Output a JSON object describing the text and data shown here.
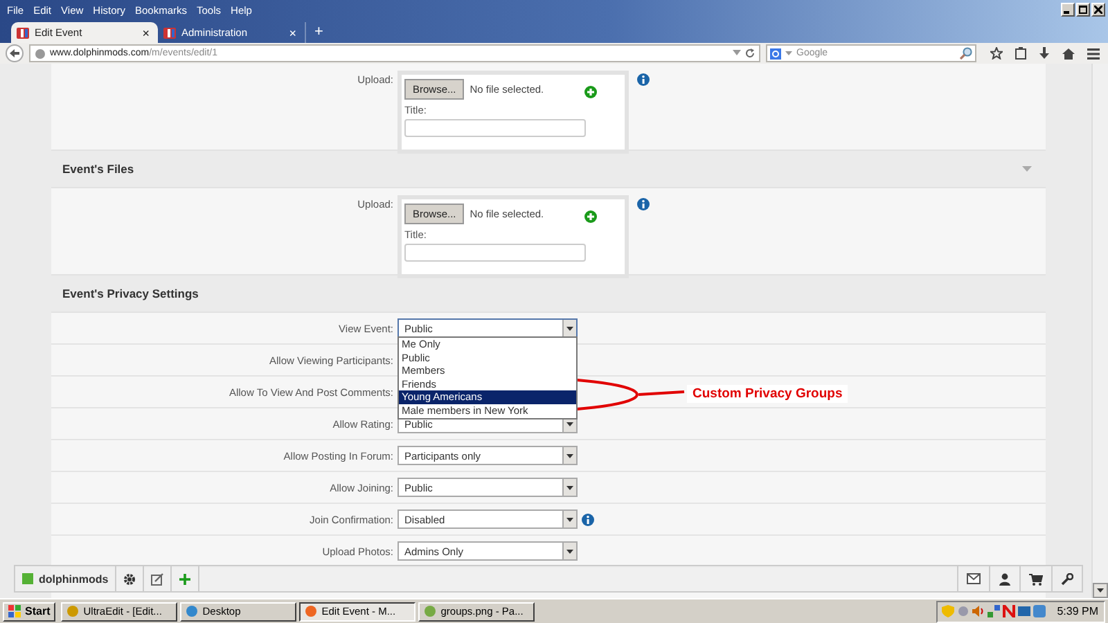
{
  "browser": {
    "menu": [
      "File",
      "Edit",
      "View",
      "History",
      "Bookmarks",
      "Tools",
      "Help"
    ],
    "tabs": [
      {
        "label": "Edit Event",
        "selected": true,
        "close": "×"
      },
      {
        "label": "Administration",
        "selected": false,
        "close": "×"
      }
    ],
    "new_tab": "+",
    "url": {
      "host": "www.dolphinmods.com",
      "path": "/m/events/edit/1"
    },
    "search": {
      "placeholder": "Google"
    }
  },
  "page": {
    "top_upload": {
      "label": "Upload:",
      "button": "Browse...",
      "status": "No file selected.",
      "title_label": "Title:"
    },
    "sections": [
      {
        "title": "Event's Files",
        "expandable": true,
        "kind": "upload",
        "upload": {
          "label": "Upload:",
          "button": "Browse...",
          "status": "No file selected.",
          "title_label": "Title:"
        }
      },
      {
        "title": "Event's Privacy Settings",
        "expandable": false,
        "kind": "fields",
        "fields": [
          {
            "label": "View Event:",
            "value": "Public",
            "open": true,
            "info": false
          },
          {
            "label": "Allow Viewing Participants:",
            "open": false,
            "info": false
          },
          {
            "label": "Allow To View And Post Comments:",
            "open": false,
            "info": false
          },
          {
            "label": "Allow Rating:",
            "value": "Public",
            "open": false,
            "info": false
          },
          {
            "label": "Allow Posting In Forum:",
            "value": "Participants only",
            "open": false,
            "info": false
          },
          {
            "label": "Allow Joining:",
            "value": "Public",
            "open": false,
            "info": false
          },
          {
            "label": "Join Confirmation:",
            "value": "Disabled",
            "open": false,
            "info": true
          },
          {
            "label": "Upload Photos:",
            "value": "Admins Only",
            "open": false,
            "info": false
          }
        ]
      }
    ],
    "dropdown": {
      "options": [
        {
          "label": "Me Only",
          "selected": false
        },
        {
          "label": "Public",
          "selected": false
        },
        {
          "label": "Members",
          "selected": false
        },
        {
          "label": "Friends",
          "selected": false
        },
        {
          "label": "Young Americans",
          "selected": true
        },
        {
          "label": "Male members in New York",
          "selected": false
        }
      ]
    },
    "annotation": {
      "text": "Custom Privacy Groups"
    }
  },
  "site_toolbar": {
    "site": "dolphinmods"
  },
  "taskbar": {
    "start": "Start",
    "tasks": [
      {
        "label": "UltraEdit - [Edit...",
        "selected": false
      },
      {
        "label": "Desktop",
        "selected": false
      },
      {
        "label": "Edit Event - M...",
        "selected": true
      },
      {
        "label": "groups.png - Pa...",
        "selected": false
      }
    ],
    "clock": "5:39 PM"
  }
}
